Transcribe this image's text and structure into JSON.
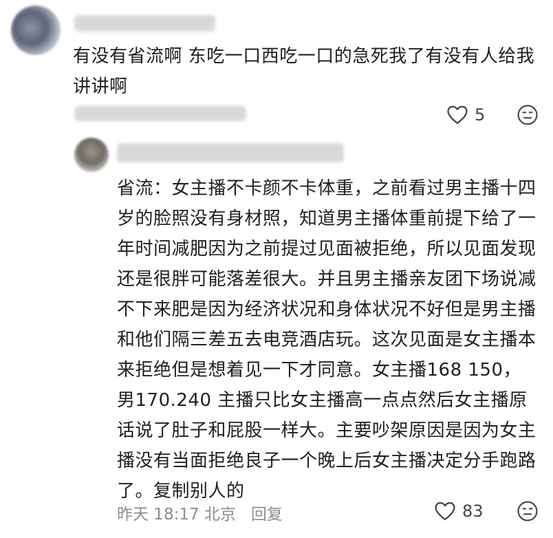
{
  "comment": {
    "text": "有没有省流啊 东吃一口西吃一口的急死我了有没有人给我讲讲啊",
    "like_icon": "heart-outline-icon",
    "like_count": "5",
    "dislike_icon": "neutral-face-icon"
  },
  "reply": {
    "text": "省流：女主播不卡颜不卡体重，之前看过男主播十四岁的脸照没有身材照，知道男主播体重前提下给了一年时间减肥因为之前提过见面被拒绝，所以见面发现还是很胖可能落差很大。并且男主播亲友团下场说减不下来肥是因为经济状况和身体状况不好但是男主播和他们隔三差五去电竞酒店玩。这次见面是女主播本来拒绝但是想着见一下才同意。女主播168 150，男170.240 主播只比女主播高一点点然后女主播原话说了肚子和屁股一样大。主要吵架原因是因为女主播没有当面拒绝良子一个晚上后女主播决定分手跑路了。复制别人的",
    "time": "昨天 18:17 北京",
    "reply_label": "回复",
    "like_icon": "heart-outline-icon",
    "like_count": "83",
    "dislike_icon": "neutral-face-icon"
  }
}
